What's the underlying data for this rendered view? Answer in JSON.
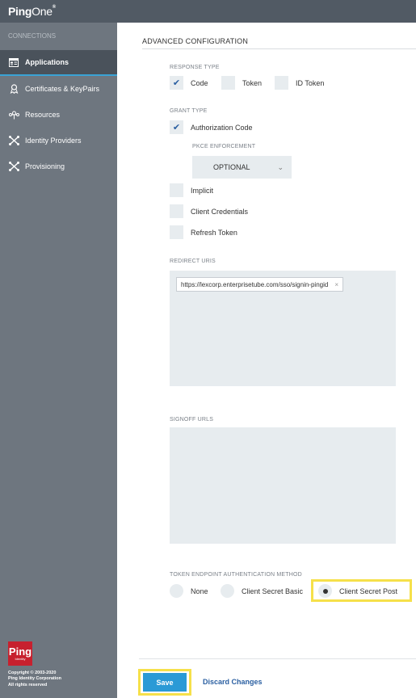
{
  "app": {
    "brand_ping": "Ping",
    "brand_one": "One",
    "brand_mark": "®"
  },
  "sidebar": {
    "section": "CONNECTIONS",
    "items": [
      {
        "label": "Applications",
        "icon": "applications-icon"
      },
      {
        "label": "Certificates & KeyPairs",
        "icon": "certificate-icon"
      },
      {
        "label": "Resources",
        "icon": "resources-icon"
      },
      {
        "label": "Identity Providers",
        "icon": "identity-providers-icon"
      },
      {
        "label": "Provisioning",
        "icon": "provisioning-icon"
      }
    ],
    "footer": {
      "logo_text": "Ping",
      "logo_sub": "Identity",
      "copyright_1": "Copyright © 2003-2020",
      "copyright_2": "Ping Identity Corporation",
      "copyright_3": "All rights reserved"
    }
  },
  "main": {
    "title": "ADVANCED CONFIGURATION",
    "response_type": {
      "label": "RESPONSE TYPE",
      "options": [
        {
          "label": "Code",
          "checked": true
        },
        {
          "label": "Token",
          "checked": false
        },
        {
          "label": "ID Token",
          "checked": false
        }
      ]
    },
    "grant_type": {
      "label": "GRANT TYPE",
      "options": [
        {
          "label": "Authorization Code",
          "checked": true
        },
        {
          "label": "Implicit",
          "checked": false
        },
        {
          "label": "Client Credentials",
          "checked": false
        },
        {
          "label": "Refresh Token",
          "checked": false
        }
      ],
      "pkce_label": "PKCE ENFORCEMENT",
      "pkce_value": "OPTIONAL"
    },
    "redirect_uris": {
      "label": "REDIRECT URIS",
      "values": [
        "https://lexcorp.enterprisetube.com/sso/signin-pingid"
      ],
      "remove_glyph": "×"
    },
    "signoff_urls": {
      "label": "SIGNOFF URLS"
    },
    "token_auth": {
      "label": "TOKEN ENDPOINT AUTHENTICATION METHOD",
      "options": [
        {
          "label": "None",
          "selected": false
        },
        {
          "label": "Client Secret Basic",
          "selected": false
        },
        {
          "label": "Client Secret Post",
          "selected": true
        }
      ]
    },
    "actions": {
      "save": "Save",
      "discard": "Discard Changes"
    }
  },
  "colors": {
    "accent": "#2a9ad6",
    "highlight": "#f6e04a",
    "sidebar": "#6e767f",
    "topbar": "#515a64",
    "brand_red": "#c7202e"
  }
}
